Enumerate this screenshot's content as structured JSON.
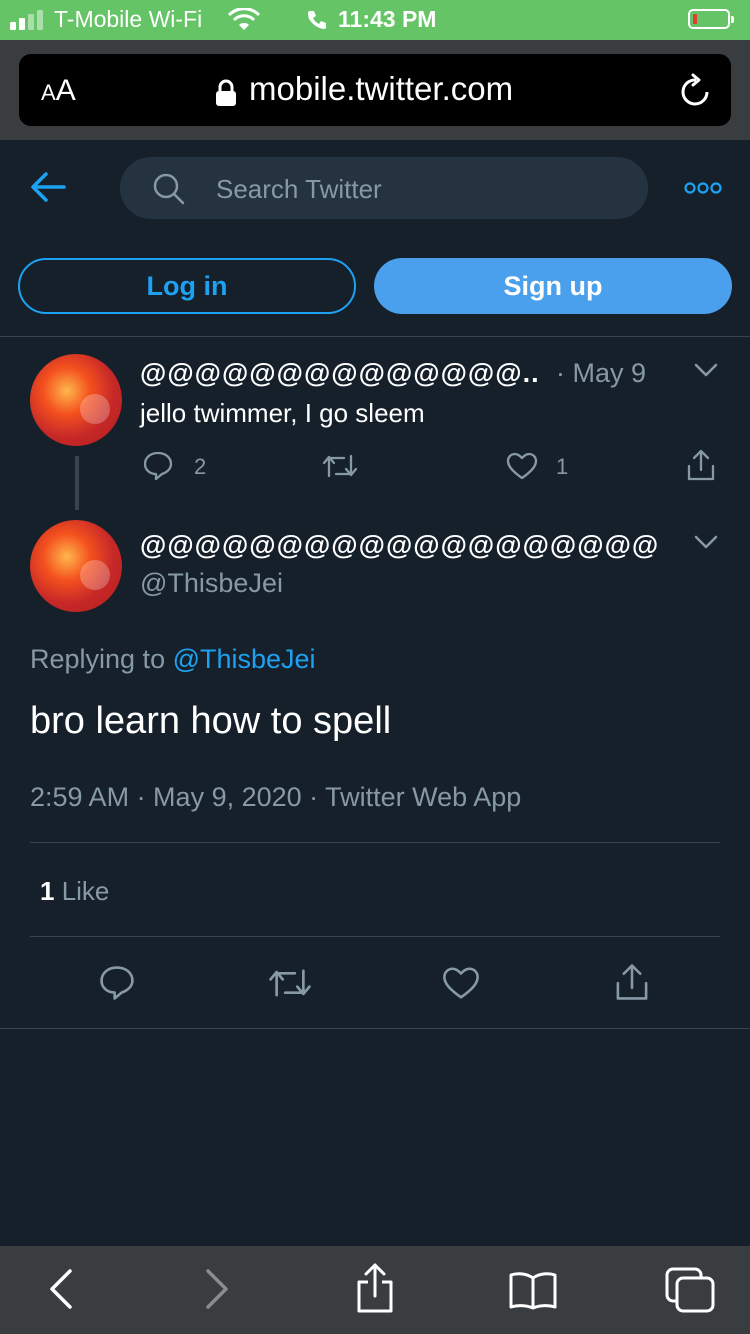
{
  "status_bar": {
    "carrier": "T-Mobile Wi-Fi",
    "time": "11:43 PM",
    "battery_color": "#e53935",
    "bar_color": "#64c466"
  },
  "browser": {
    "text_size_label_small": "A",
    "text_size_label_large": "A",
    "url": "mobile.twitter.com"
  },
  "header": {
    "search_placeholder": "Search Twitter"
  },
  "auth": {
    "login_label": "Log in",
    "signup_label": "Sign up"
  },
  "parent_tweet": {
    "name": "@@@@@@@@@@@@@@...",
    "date": "· May 9",
    "text": "jello twimmer, I go sleem",
    "reply_count": "2",
    "like_count": "1"
  },
  "main_tweet": {
    "name": "@@@@@@@@@@@@@@@@@@@...",
    "handle": "@ThisbeJei",
    "replying_prefix": "Replying to ",
    "replying_handle": "@ThisbeJei",
    "text": "bro learn how to spell",
    "timestamp": "2:59 AM · May 9, 2020 · Twitter Web App",
    "likes_count": "1",
    "likes_label": " Like"
  },
  "colors": {
    "background": "#15202b",
    "accent": "#1da1f2",
    "secondary_text": "#8899a6",
    "divider": "#38444d"
  }
}
